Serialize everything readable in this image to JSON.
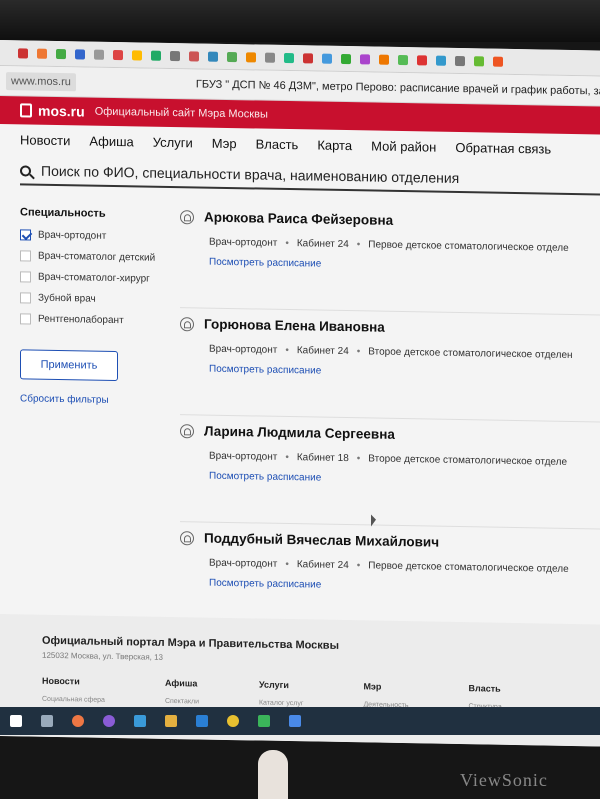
{
  "browser": {
    "url": "www.mos.ru",
    "page_title": "ГБУЗ \" ДСП № 46 ДЗМ\", метро Перово: расписание врачей и график работы, за"
  },
  "header": {
    "brand": "mos.ru",
    "brand_sub": "Официальный сайт Мэра Москвы",
    "brand_color": "#c8102e"
  },
  "nav": [
    "Новости",
    "Афиша",
    "Услуги",
    "Мэр",
    "Власть",
    "Карта",
    "Мой район",
    "Обратная связь"
  ],
  "search": {
    "placeholder": "Поиск по ФИО, специальности врача, наименованию отделения"
  },
  "filters": {
    "title": "Специальность",
    "items": [
      {
        "label": "Врач-ортодонт",
        "checked": true
      },
      {
        "label": "Врач-стоматолог детский",
        "checked": false
      },
      {
        "label": "Врач-стоматолог-хирург",
        "checked": false
      },
      {
        "label": "Зубной врач",
        "checked": false
      },
      {
        "label": "Рентгенолаборант",
        "checked": false
      }
    ],
    "apply_label": "Применить",
    "reset_label": "Сбросить фильтры"
  },
  "doctors": [
    {
      "name": "Арюкова Раиса Фейзеровна",
      "specialty": "Врач-ортодонт",
      "cabinet": "Кабинет 24",
      "department": "Первое детское стоматологическое отделе",
      "link": "Посмотреть расписание"
    },
    {
      "name": "Горюнова Елена Ивановна",
      "specialty": "Врач-ортодонт",
      "cabinet": "Кабинет 24",
      "department": "Второе детское стоматологическое отделен",
      "link": "Посмотреть расписание"
    },
    {
      "name": "Ларина Людмила Сергеевна",
      "specialty": "Врач-ортодонт",
      "cabinet": "Кабинет 18",
      "department": "Второе детское стоматологическое отделе",
      "link": "Посмотреть расписание"
    },
    {
      "name": "Поддубный Вячеслав Михайлович",
      "specialty": "Врач-ортодонт",
      "cabinet": "Кабинет 24",
      "department": "Первое детское стоматологическое отделе",
      "link": "Посмотреть расписание"
    }
  ],
  "footer": {
    "title": "Официальный портал Мэра и Правительства Москвы",
    "address": "125032 Москва, ул. Тверская, 13",
    "columns": [
      {
        "title": "Новости",
        "sub": "Социальная сфера"
      },
      {
        "title": "Афиша",
        "sub": "Спектакли"
      },
      {
        "title": "Услуги",
        "sub": "Каталог услуг"
      },
      {
        "title": "Мэр",
        "sub": "Деятельность"
      },
      {
        "title": "Власть",
        "sub": "Структура"
      }
    ]
  },
  "monitor_brand": "ViewSonic"
}
